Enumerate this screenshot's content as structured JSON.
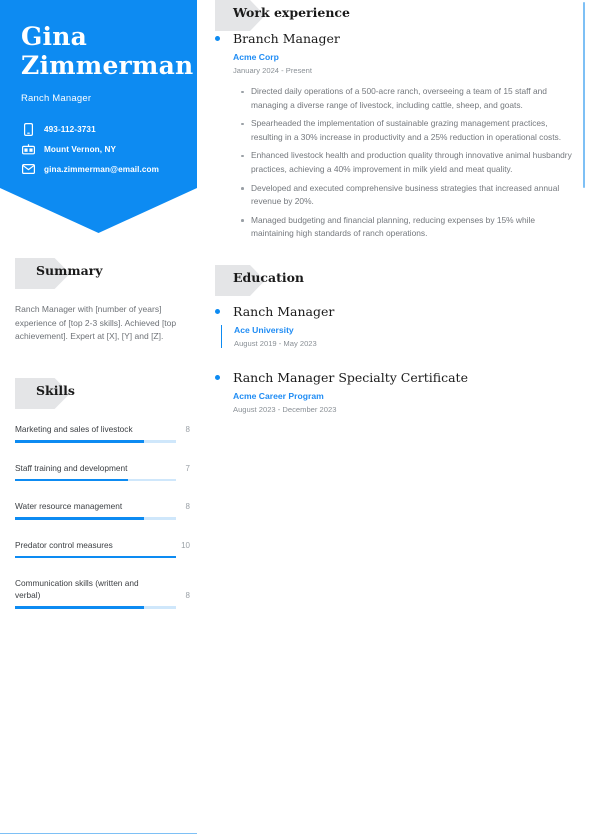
{
  "colors": {
    "accent": "#0d8bf2",
    "accent_light": "#cfe7fb",
    "tag_gray": "#e4e5e7",
    "body_text": "#74787d",
    "heading_text": "#1a1a1a"
  },
  "header": {
    "first_name": "Gina",
    "last_name": "Zimmerman",
    "job_title": "Ranch Manager",
    "contacts": [
      {
        "icon": "phone-icon",
        "text": "493-112-3731"
      },
      {
        "icon": "location-icon",
        "text": "Mount Vernon, NY"
      },
      {
        "icon": "email-icon",
        "text": "gina.zimmerman@email.com"
      }
    ]
  },
  "summary": {
    "heading": "Summary",
    "text": "Ranch Manager with [number of years] experience of [top 2-3 skills]. Achieved [top achievement]. Expert at [X], [Y] and [Z]."
  },
  "skills": {
    "heading": "Skills",
    "max_score": 10,
    "items": [
      {
        "name": "Marketing and sales of livestock",
        "score": "8",
        "percent": 80
      },
      {
        "name": "Staff training and development",
        "score": "7",
        "percent": 70
      },
      {
        "name": "Water resource management",
        "score": "8",
        "percent": 80
      },
      {
        "name": "Predator control measures",
        "score": "10",
        "percent": 100
      },
      {
        "name": "Communication skills (written and verbal)",
        "score": "8",
        "percent": 80
      }
    ]
  },
  "work_experience": {
    "heading": "Work experience",
    "entries": [
      {
        "title": "Branch Manager",
        "organization": "Acme Corp",
        "dates": "January 2024 - Present",
        "bullets": [
          "Directed daily operations of a 500-acre ranch, overseeing a team of 15 staff and managing a diverse range of livestock, including cattle, sheep, and goats.",
          "Spearheaded the implementation of sustainable grazing management practices, resulting in a 30% increase in productivity and a 25% reduction in operational costs.",
          "Enhanced livestock health and production quality through innovative animal husbandry practices, achieving a 40% improvement in milk yield and meat quality.",
          "Developed and executed comprehensive business strategies that increased annual revenue by 20%.",
          "Managed budgeting and financial planning, reducing expenses by 15% while maintaining high standards of ranch operations."
        ]
      }
    ]
  },
  "education": {
    "heading": "Education",
    "entries": [
      {
        "title": "Ranch Manager",
        "organization": "Ace University",
        "dates": "August 2019 - May 2023"
      },
      {
        "title": "Ranch Manager Specialty Certificate",
        "organization": "Acme Career Program",
        "dates": "August 2023 - December 2023"
      }
    ]
  }
}
